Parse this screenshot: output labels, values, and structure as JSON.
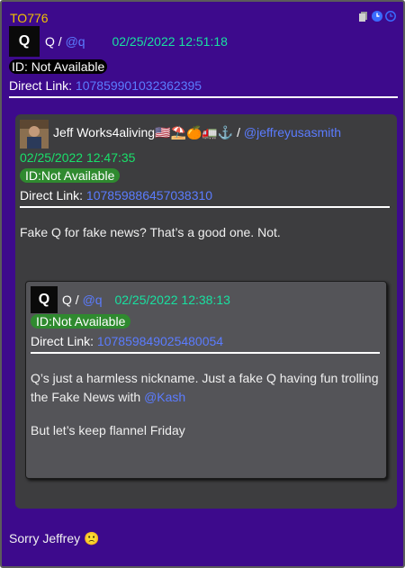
{
  "drop": {
    "id": "TO776",
    "author_name": "Q",
    "author_handle": "@q",
    "date": "02/25/2022 12:51:18",
    "id_badge": "ID: Not Available",
    "direct_link_label": "Direct Link:",
    "direct_link": "1078599010323623​95",
    "footer_text": "Sorry Jeffrey 🙁"
  },
  "icons": [
    "document-icon",
    "clock-icon",
    "clock-outline-icon"
  ],
  "quoted": {
    "author_name": "Jeff Works4aliving🇺🇸⛱️🍊🚛⚓",
    "separator": " / ",
    "author_handle": "@jeffreyusasmith",
    "date": "02/25/2022 12:47:35",
    "id_badge": "ID:Not Available",
    "direct_link_label": "Direct Link:",
    "direct_link": "1078598864570383​10",
    "text": "Fake Q for fake news? That’s a good one. Not."
  },
  "nested": {
    "author_name": "Q",
    "author_handle": "@q",
    "date": "02/25/2022 12:38:13",
    "id_badge": "ID:Not Available",
    "direct_link_label": "Direct Link:",
    "direct_link": "1078598490254800​54",
    "text_pre": "Q’s just a harmless nickname. Just a fake Q having fun trolling the Fake News with ",
    "mention": "@Kash",
    "text2": "But let’s keep flannel Friday"
  }
}
